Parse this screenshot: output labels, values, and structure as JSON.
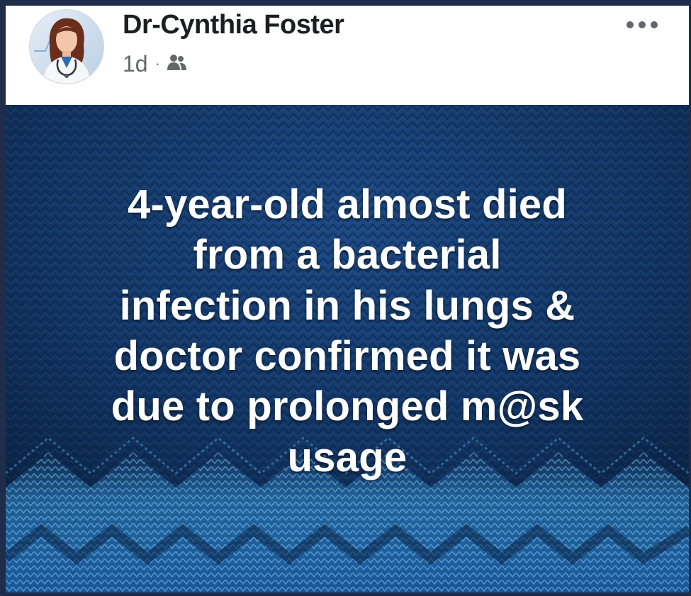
{
  "post": {
    "author": "Dr-Cynthia Foster",
    "time": "1d",
    "separator": "·",
    "audience_icon": "friends-icon",
    "more_icon": "more-options-icon",
    "image_text": "4-year-old almost died\nfrom a bacterial\ninfection in his lungs &\ndoctor confirmed it was\ndue to prolonged m@sk\nusage"
  },
  "colors": {
    "name": "#1c1e21",
    "meta": "#65676b",
    "image_bg_dark": "#0b1f3d",
    "image_bg_light": "#1e4c88",
    "pattern_cyan": "#3fa9e6"
  }
}
